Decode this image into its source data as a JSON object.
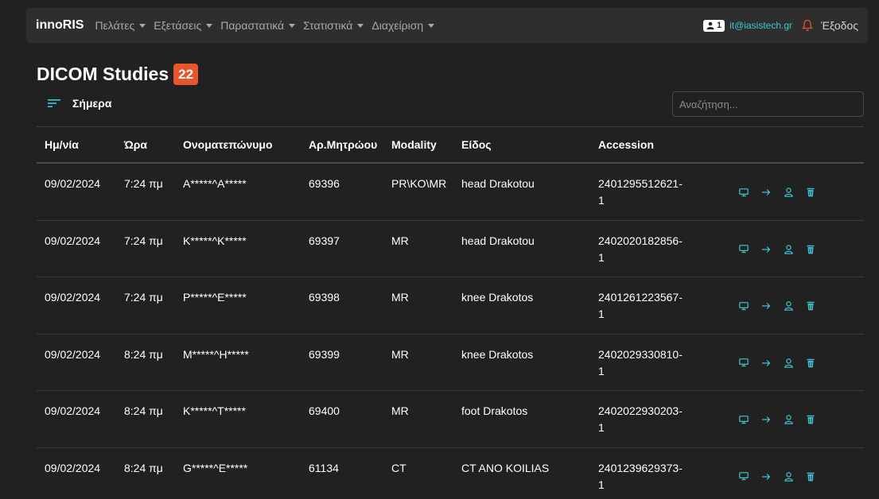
{
  "nav": {
    "brand": "innoRIS",
    "menu": [
      "Πελάτες",
      "Εξετάσεις",
      "Παραστατικά",
      "Στατιστικά",
      "Διαχείριση"
    ],
    "user_count": "1",
    "user_email": "it@iasistech.gr",
    "logout": "Έξοδος"
  },
  "page": {
    "title": "DICOM Studies",
    "count": "22",
    "filter_label": "Σήμερα",
    "search_placeholder": "Αναζήτηση..."
  },
  "table": {
    "headers": [
      "Ημ/νία",
      "Ώρα",
      "Ονοματεπώνυμο",
      "Αρ.Μητρώου",
      "Modality",
      "Είδος",
      "Accession"
    ],
    "rows": [
      {
        "date": "09/02/2024",
        "time": "7:24 πμ",
        "name": "A*****^A*****",
        "reg": "69396",
        "modality": "PR\\KO\\MR",
        "type": "head Drakotou",
        "accession": "2401295512621-\n1"
      },
      {
        "date": "09/02/2024",
        "time": "7:24 πμ",
        "name": "K*****^K*****",
        "reg": "69397",
        "modality": "MR",
        "type": "head Drakotou",
        "accession": "2402020182856-\n1"
      },
      {
        "date": "09/02/2024",
        "time": "7:24 πμ",
        "name": "P*****^E*****",
        "reg": "69398",
        "modality": "MR",
        "type": "knee Drakotos",
        "accession": "2401261223567-\n1"
      },
      {
        "date": "09/02/2024",
        "time": "8:24 πμ",
        "name": "M*****^H*****",
        "reg": "69399",
        "modality": "MR",
        "type": "knee Drakotos",
        "accession": "2402029330810-\n1"
      },
      {
        "date": "09/02/2024",
        "time": "8:24 πμ",
        "name": "K*****^T*****",
        "reg": "69400",
        "modality": "MR",
        "type": "foot Drakotos",
        "accession": "2402022930203-\n1"
      },
      {
        "date": "09/02/2024",
        "time": "8:24 πμ",
        "name": "G*****^E*****",
        "reg": "61134",
        "modality": "CT",
        "type": "CT ANO KOILIAS",
        "accession": "2401239629373-\n1"
      }
    ],
    "row_actions": [
      "monitor-icon",
      "arrow-right-icon",
      "user-icon",
      "trash-icon"
    ]
  },
  "colors": {
    "accent": "#3ec7d4",
    "badge": "#e8542b",
    "background": "#212121",
    "navbar": "#2e2e2e"
  }
}
